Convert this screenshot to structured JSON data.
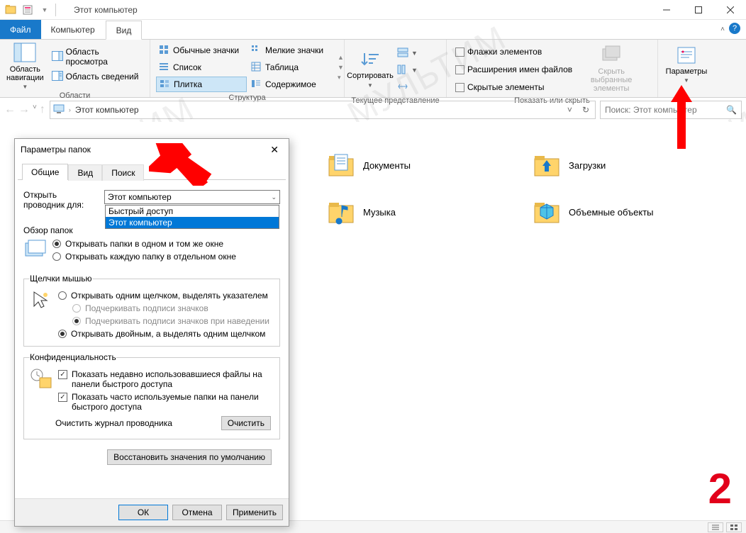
{
  "window_title": "Этот компьютер",
  "menu": {
    "file": "Файл",
    "computer": "Компьютер",
    "view": "Вид"
  },
  "ribbon": {
    "panes": {
      "nav_area": "Область навигации",
      "preview_area": "Область просмотра",
      "details_area": "Область сведений",
      "group_label": "Области"
    },
    "layout": {
      "normal_icons": "Обычные значки",
      "small_icons": "Мелкие значки",
      "list": "Список",
      "table": "Таблица",
      "tiles": "Плитка",
      "content": "Содержимое",
      "group_label": "Структура"
    },
    "current_view": {
      "sort": "Сортировать",
      "group_label": "Текущее представление"
    },
    "show_hide": {
      "item_checkboxes": "Флажки элементов",
      "file_ext": "Расширения имен файлов",
      "hidden_items": "Скрытые элементы",
      "hide_selected": "Скрыть выбранные элементы",
      "group_label": "Показать или скрыть"
    },
    "options": {
      "label": "Параметры"
    }
  },
  "address": {
    "root": "Этот компьютер"
  },
  "search": {
    "placeholder": "Поиск: Этот компьютер"
  },
  "folders": {
    "documents": "Документы",
    "downloads": "Загрузки",
    "music": "Музыка",
    "objects3d": "Объемные объекты"
  },
  "dialog": {
    "title": "Параметры папок",
    "tabs": {
      "general": "Общие",
      "view": "Вид",
      "search": "Поиск"
    },
    "open_for_label": "Открыть проводник для:",
    "open_for_value": "Этот компьютер",
    "open_for_options": [
      "Быстрый доступ",
      "Этот компьютер"
    ],
    "browse_label": "Обзор папок",
    "browse_same": "Открывать папки в одном и том же окне",
    "browse_new": "Открывать каждую папку в отдельном окне",
    "click_label": "Щелчки мышью",
    "click_single": "Открывать одним щелчком, выделять указателем",
    "click_underline_always": "Подчеркивать подписи значков",
    "click_underline_hover": "Подчеркивать подписи значков при наведении",
    "click_double": "Открывать двойным, а выделять одним щелчком",
    "privacy_label": "Конфиденциальность",
    "privacy_recent": "Показать недавно использовавшиеся файлы на панели быстрого доступа",
    "privacy_frequent": "Показать часто используемые папки на панели быстрого доступа",
    "clear_history_label": "Очистить журнал проводника",
    "clear_btn": "Очистить",
    "restore_defaults": "Восстановить значения по умолчанию",
    "ok": "ОК",
    "cancel": "Отмена",
    "apply": "Применить"
  },
  "annotation_number": "2",
  "watermark": "МУЛЬТИМ"
}
